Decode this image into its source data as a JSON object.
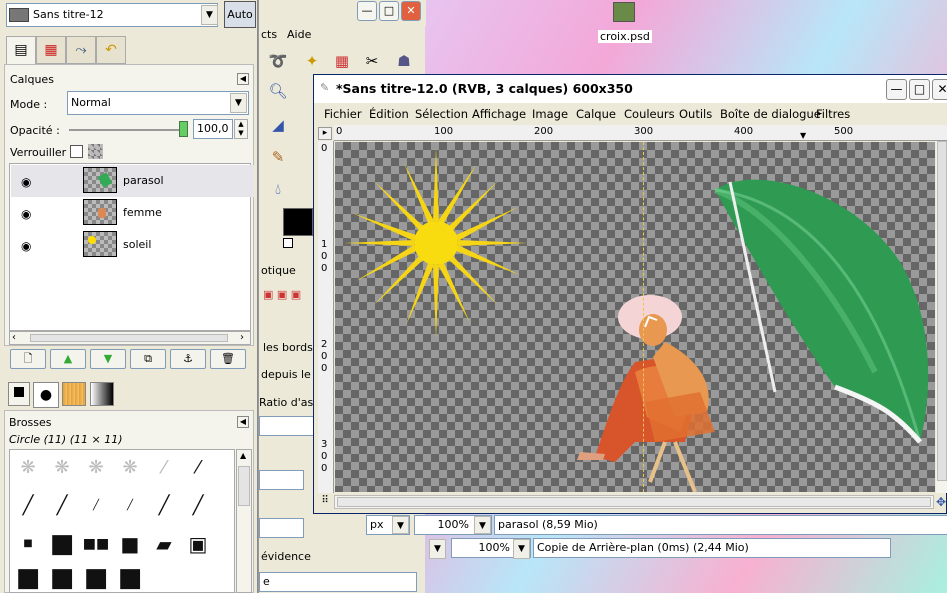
{
  "desktop": {
    "icon_label": "croix.psd"
  },
  "dock": {
    "image_name": "Sans titre-12",
    "auto_label": "Auto",
    "tabs": [
      "layers-icon",
      "channels-icon",
      "paths-icon",
      "undo-icon"
    ],
    "panel_title": "Calques",
    "mode_label": "Mode :",
    "mode_value": "Normal",
    "opacity_label": "Opacité :",
    "opacity_value": "100,0",
    "opacity_level": 1.0,
    "lock_label": "Verrouiller :",
    "layers": [
      {
        "name": "parasol",
        "selected": true
      },
      {
        "name": "femme",
        "selected": false
      },
      {
        "name": "soleil",
        "selected": false
      }
    ],
    "layer_buttons": [
      "new-layer-icon",
      "raise-layer-icon",
      "lower-layer-icon",
      "duplicate-layer-icon",
      "anchor-layer-icon",
      "delete-layer-icon"
    ],
    "brushes_title": "Brosses",
    "brush_info": "Circle (11) (11 × 11)"
  },
  "toolbox": {
    "menu_partial": "cts",
    "menu_help": "Aide",
    "opt_title": "otique",
    "opt_borders": "les bords",
    "opt_from": "depuis le",
    "opt_ratio": "Ratio d'aspe",
    "opt_highlight": "évidence"
  },
  "image_window": {
    "title": "*Sans titre-12.0 (RVB, 3 calques) 600x350",
    "menu": [
      "Fichier",
      "Édition",
      "Sélection",
      "Affichage",
      "Image",
      "Calque",
      "Couleurs",
      "Outils",
      "Boîte de dialogue",
      "Filtres"
    ],
    "ruler_top": [
      "0",
      "100",
      "200",
      "300",
      "400",
      "500"
    ],
    "ruler_left": [
      "0",
      "1\n0\n0",
      "2\n0\n0",
      "3\n0\n0"
    ],
    "unit": "px",
    "zoom": "100%",
    "status": "parasol (8,59 Mio)"
  },
  "back_window": {
    "zoom": "100%",
    "status": "Copie de Arrière-plan (0ms) (2,44 Mio)"
  },
  "colors": {
    "sun": "#f5d515",
    "umbrella": "#3aa05a",
    "titlebar_active": "#0a246a"
  }
}
